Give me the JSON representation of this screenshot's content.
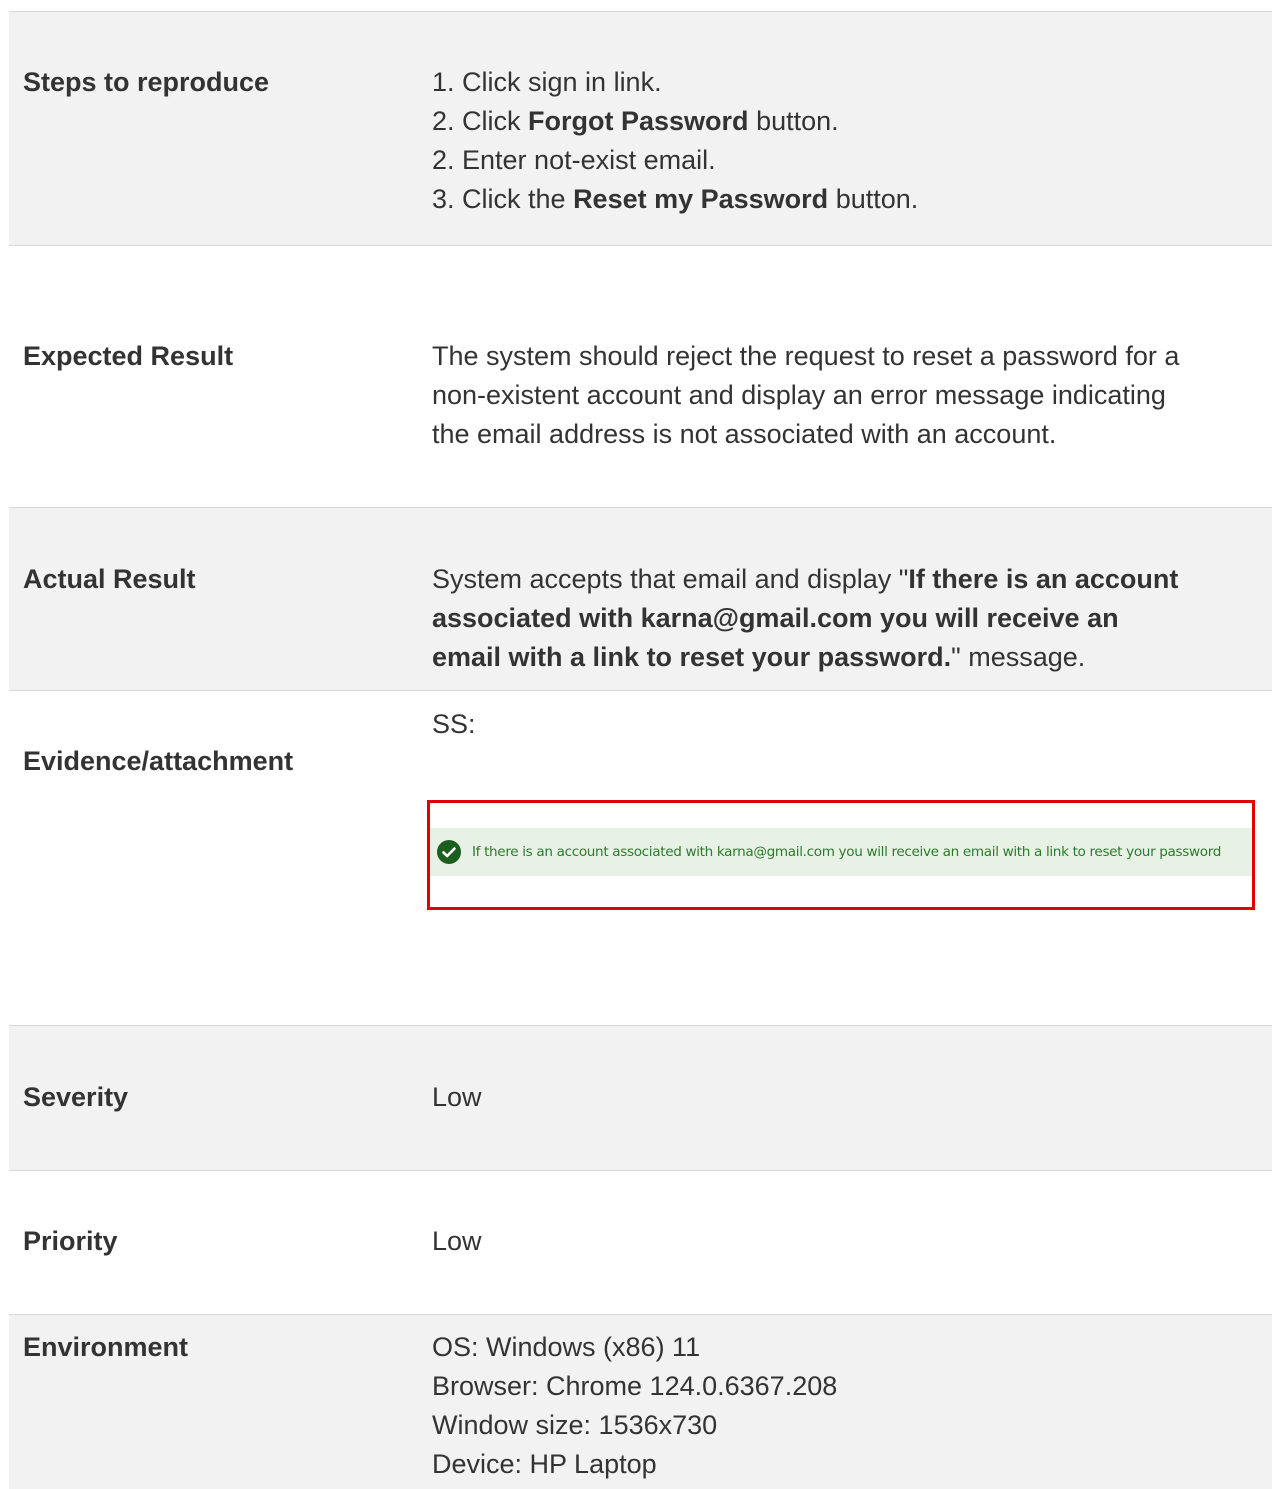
{
  "rows": {
    "steps": {
      "label": "Steps to reproduce",
      "items": [
        {
          "pre": "1. Click sign in link.",
          "bold": "",
          "post": ""
        },
        {
          "pre": "2. Click ",
          "bold": "Forgot Password",
          "post": " button."
        },
        {
          "pre": "2. Enter not-exist email.",
          "bold": "",
          "post": ""
        },
        {
          "pre": "3. Click the ",
          "bold": "Reset my Password",
          "post": " button."
        }
      ]
    },
    "expected": {
      "label": "Expected Result",
      "lines": [
        "The system should reject the request to reset a password for a",
        "non-existent account and display an error message indicating",
        "the email address is not associated with an account."
      ]
    },
    "actual": {
      "label": "Actual Result",
      "line1_pre": "System accepts that email and display \"",
      "line1_bold": "If there is an account",
      "line2_bold": "associated with karna@gmail.com you will receive an",
      "line3_bold": "email with a link to reset your password.",
      "line3_post": "\" message."
    },
    "evidence": {
      "label": "Evidence/attachment",
      "caption": "SS:",
      "alert_text": "If there is an account associated with karna@gmail.com you will receive an email with a link to reset your password",
      "alert_icon": "check-circle-icon",
      "highlight_color": "#e50000",
      "alert_bg": "#e8f1e6",
      "alert_text_color": "#2c7a2c"
    },
    "severity": {
      "label": "Severity",
      "value": "Low"
    },
    "priority": {
      "label": "Priority",
      "value": "Low"
    },
    "environment": {
      "label": "Environment",
      "lines": [
        "OS: Windows (x86) 11",
        "Browser: Chrome 124.0.6367.208",
        "Window size: 1536x730",
        "Device: HP Laptop"
      ]
    }
  }
}
